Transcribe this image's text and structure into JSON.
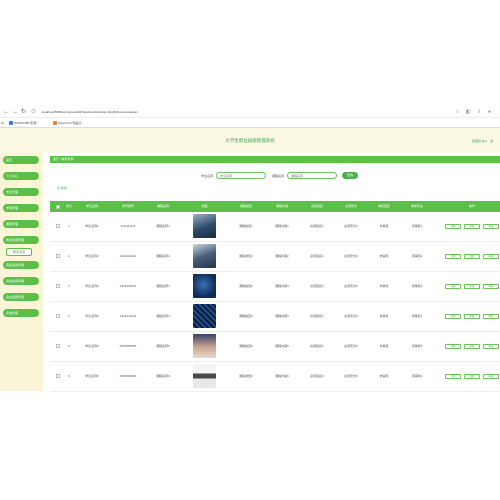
{
  "browser": {
    "url": "localhost:8080/springboot4d37b/admin/dist/index.html#/chouxiumkaiuan",
    "bookmarks": [
      "SSSPC2B1 影视...",
      "SuperC16 作品分..."
    ]
  },
  "header": {
    "title": "大学生职业技能管理系统",
    "user": "管理员 abo",
    "logout": "退"
  },
  "sidebar": {
    "items": [
      "首页",
      "个人中心",
      "学生管理",
      "学院管理",
      "课程管理",
      "教学资源管理",
      "实践活动管理",
      "就业指导管理",
      "企业招聘管理",
      "系统管理"
    ],
    "active_sub": "教学资源"
  },
  "breadcrumb": {
    "home": "首页",
    "sep": "/",
    "current": "教学资源"
  },
  "search": {
    "label1": "学生名称",
    "placeholder1": "学生名称",
    "label2": "课程名称",
    "placeholder2": "课程名称",
    "button": "查询"
  },
  "actions": {
    "add": "新增"
  },
  "table": {
    "headers": [
      "索引",
      "学生名称",
      "学号编号",
      "课程名称",
      "封面",
      "课程类型",
      "课程内容",
      "资源链接",
      "资源形式",
      "审核回复",
      "审核状态",
      "操作"
    ],
    "rows": [
      {
        "index": "1",
        "name": "学生名称1",
        "no": "1111111111",
        "course": "课程名称1",
        "type": "课程类型1",
        "content": "课程内容1",
        "link": "资源链接1",
        "form": "资源形式1",
        "reply": "未审核",
        "status": "待审核1"
      },
      {
        "index": "2",
        "name": "学生名称2",
        "no": "2222222222",
        "course": "课程名称2",
        "type": "课程类型2",
        "content": "课程内容2",
        "link": "资源链接2",
        "form": "资源形式2",
        "reply": "未审核",
        "status": "待审核2"
      },
      {
        "index": "3",
        "name": "学生名称3",
        "no": "3333333333",
        "course": "课程名称3",
        "type": "课程类型3",
        "content": "课程内容3",
        "link": "资源链接3",
        "form": "资源形式3",
        "reply": "未审核",
        "status": "待审核3"
      },
      {
        "index": "4",
        "name": "学生名称4",
        "no": "4444444444",
        "course": "课程名称4",
        "type": "课程类型4",
        "content": "课程内容4",
        "link": "资源链接4",
        "form": "资源形式4",
        "reply": "未审核",
        "status": "待审核4"
      },
      {
        "index": "5",
        "name": "学生名称5",
        "no": "5555555555",
        "course": "课程名称5",
        "type": "课程类型5",
        "content": "课程内容5",
        "link": "资源链接5",
        "form": "资源形式5",
        "reply": "未审核",
        "status": "待审核5"
      },
      {
        "index": "6",
        "name": "学生名称6",
        "no": "6666666666",
        "course": "课程名称6",
        "type": "课程类型6",
        "content": "课程内容6",
        "link": "资源链接6",
        "form": "资源形式6",
        "reply": "未审核",
        "status": "待审核6"
      }
    ],
    "row_actions": [
      "详情",
      "修改",
      "审核",
      "删除"
    ]
  },
  "colors": {
    "accent": "#5cbf4a",
    "header_bg": "#fbf8e4",
    "sidebar_bg": "#fbf5d8"
  }
}
